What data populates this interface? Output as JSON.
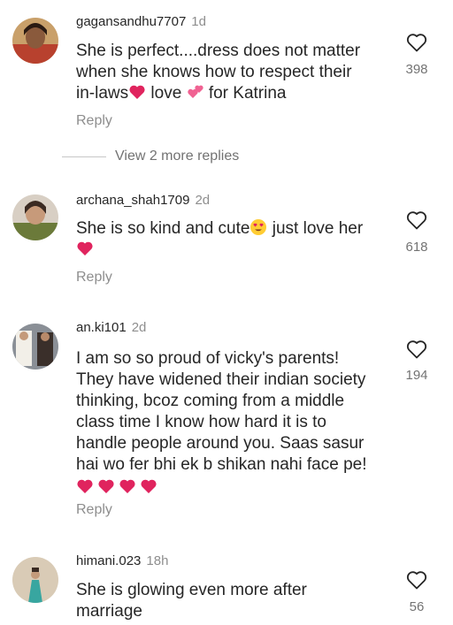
{
  "comments": [
    {
      "username": "gagansandhu7707",
      "time": "1d",
      "text_line1": "She is perfect....dress does not matter",
      "text_line2": "when she knows how to respect their",
      "text_line3a": "in-laws",
      "text_line3b": " love ",
      "text_line3c": " for Katrina",
      "reply": "Reply",
      "likes": "398"
    },
    {
      "username": "archana_shah1709",
      "time": "2d",
      "text_line1a": "She is so kind and cute",
      "text_line1b": " just love her",
      "reply": "Reply",
      "likes": "618"
    },
    {
      "username": "an.ki101",
      "time": "2d",
      "lines": [
        "I am so so proud of vicky's parents!",
        "They have widened their indian society",
        "thinking, bcoz coming from a middle",
        "class time I know how hard it is to",
        "handle people around you. Saas sasur",
        "hai wo fer bhi ek b shikan nahi face pe!"
      ],
      "reply": "Reply",
      "likes": "194"
    },
    {
      "username": "himani.023",
      "time": "18h",
      "text_line1": "She is glowing even more after",
      "text_line2": "marriage",
      "likes": "56"
    }
  ],
  "view_more": "View 2 more replies",
  "colors": {
    "heart_emoji": "#e0245e",
    "text": "#262626",
    "muted": "#8e8e8e"
  },
  "icons": [
    "heart-outline-icon",
    "red-heart-emoji",
    "two-hearts-emoji",
    "heart-eyes-emoji"
  ]
}
